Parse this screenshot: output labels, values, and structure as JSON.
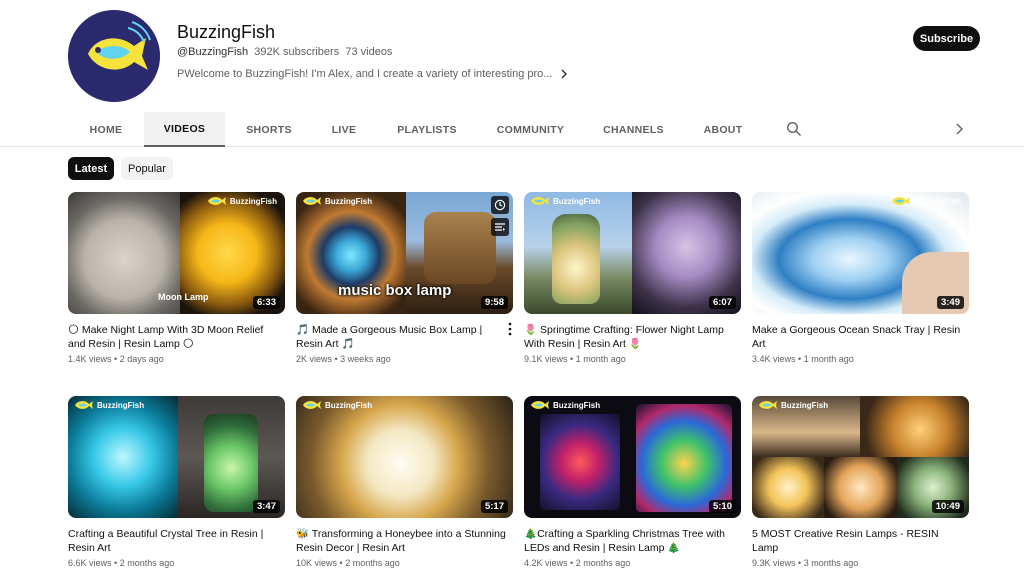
{
  "channel": {
    "name": "BuzzingFish",
    "handle": "@BuzzingFish",
    "subscribers": "392K subscribers",
    "videos": "73 videos",
    "description": "PWelcome to BuzzingFish! I'm Alex, and I create a variety of interesting pro...",
    "avatar_text": "BuzzingFish",
    "subscribe_label": "Subscribe"
  },
  "tabs": [
    {
      "label": "HOME",
      "active": false
    },
    {
      "label": "VIDEOS",
      "active": true
    },
    {
      "label": "SHORTS",
      "active": false
    },
    {
      "label": "LIVE",
      "active": false
    },
    {
      "label": "PLAYLISTS",
      "active": false
    },
    {
      "label": "COMMUNITY",
      "active": false
    },
    {
      "label": "CHANNELS",
      "active": false
    },
    {
      "label": "ABOUT",
      "active": false
    }
  ],
  "chips": [
    {
      "label": "Latest",
      "selected": true
    },
    {
      "label": "Popular",
      "selected": false
    }
  ],
  "brand_label": "BuzzingFish",
  "videos": [
    {
      "title": "🌕 Make Night Lamp With 3D Moon Relief and Resin | Resin Lamp 🌕",
      "views": "1.4K views",
      "age": "2 days ago",
      "duration": "6:33",
      "caption": "Moon Lamp"
    },
    {
      "title": "🎵 Made a Gorgeous Music Box Lamp | Resin Art 🎵",
      "views": "2K views",
      "age": "3 weeks ago",
      "duration": "9:58",
      "caption": "music box lamp"
    },
    {
      "title": "🌷 Springtime Crafting: Flower Night Lamp With Resin | Resin Art 🌷",
      "views": "9.1K views",
      "age": "1 month ago",
      "duration": "6:07",
      "caption": ""
    },
    {
      "title": "Make a Gorgeous Ocean Snack Tray | Resin Art",
      "views": "3.4K views",
      "age": "1 month ago",
      "duration": "3:49",
      "caption": ""
    },
    {
      "title": "Crafting a Beautiful Crystal Tree in Resin | Resin Art",
      "views": "6.6K views",
      "age": "2 months ago",
      "duration": "3:47",
      "caption": ""
    },
    {
      "title": "🐝 Transforming a Honeybee into a Stunning Resin Decor | Resin Art",
      "views": "10K views",
      "age": "2 months ago",
      "duration": "5:17",
      "caption": ""
    },
    {
      "title": "🎄Crafting a Sparkling Christmas Tree with LEDs and Resin | Resin Lamp 🎄",
      "views": "4.2K views",
      "age": "2 months ago",
      "duration": "5:10",
      "caption": ""
    },
    {
      "title": "5 MOST Creative Resin Lamps - RESIN Lamp",
      "views": "9.3K views",
      "age": "3 months ago",
      "duration": "10:49",
      "caption": ""
    }
  ],
  "colors": {
    "accent_dark": "#0f0f0f",
    "meta_gray": "#606060",
    "chip_bg": "#f2f2f2",
    "avatar_bg": "#2b2a6e",
    "fish_yellow": "#f5e23a",
    "fish_blue": "#5fd3f0"
  },
  "icons": {
    "tab_search": "search-icon",
    "tabs_next": "chevron-right-icon",
    "description_more": "chevron-right-icon",
    "watch_later": "clock-icon",
    "add_to_queue": "queue-icon",
    "more_actions": "kebab-menu-icon"
  }
}
